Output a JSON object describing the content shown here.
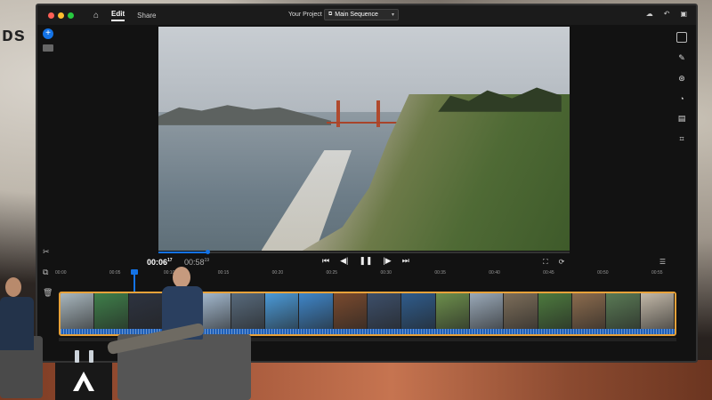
{
  "app": {
    "tabs": [
      {
        "label": "Edit",
        "active": true
      },
      {
        "label": "Share",
        "active": false
      }
    ],
    "project_label": "Your Project",
    "sequence_select": "Main Sequence",
    "accent": "#1473e6",
    "track_border": "#e8a23a"
  },
  "titlebar_icons": [
    "home-icon",
    "cloud-icon",
    "undo-icon",
    "comment-icon"
  ],
  "left_tools": [
    "add-media-icon",
    "media-panel-icon",
    "scissors-icon",
    "duplicate-icon",
    "trash-icon"
  ],
  "right_tools": [
    "properties-icon",
    "effects-icon",
    "color-icon",
    "speed-icon",
    "captions-icon",
    "crop-icon"
  ],
  "transport": {
    "current_time": "00:06",
    "current_frames": "17",
    "total_time": "00:58",
    "total_frames": "19",
    "playhead_fraction": 0.12,
    "buttons": [
      "go-to-start-icon",
      "step-back-icon",
      "pause-icon",
      "step-forward-icon",
      "go-to-end-icon"
    ]
  },
  "ruler": {
    "ticks": [
      "00:00",
      "00:05",
      "00:10",
      "00:15",
      "00:20",
      "00:25",
      "00:30",
      "00:35",
      "00:40",
      "00:45",
      "00:50",
      "00:55"
    ]
  },
  "clips": [
    {
      "color": "#a8b6bd"
    },
    {
      "color": "#3f7f4a"
    },
    {
      "color": "#2d3340"
    },
    {
      "color": "#b69a72"
    },
    {
      "color": "#a6bcd2"
    },
    {
      "color": "#586a7c"
    },
    {
      "color": "#4b9ad8"
    },
    {
      "color": "#3f86c9"
    },
    {
      "color": "#7a4a2e"
    },
    {
      "color": "#3d4f6a"
    },
    {
      "color": "#2f5c8c"
    },
    {
      "color": "#6d8f4c"
    },
    {
      "color": "#9aa9b8"
    },
    {
      "color": "#7d6e5a"
    },
    {
      "color": "#4d7a3e"
    },
    {
      "color": "#8c6c4e"
    },
    {
      "color": "#5a7a55"
    },
    {
      "color": "#c2b8a8"
    }
  ],
  "stand_logo": "adobe-logo"
}
